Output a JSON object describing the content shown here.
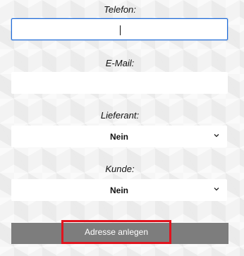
{
  "form": {
    "telefon": {
      "label": "Telefon:",
      "value": ""
    },
    "email": {
      "label": "E-Mail:",
      "value": ""
    },
    "lieferant": {
      "label": "Lieferant:",
      "selected": "Nein"
    },
    "kunde": {
      "label": "Kunde:",
      "selected": "Nein"
    },
    "submit_label": "Adresse anlegen"
  },
  "colors": {
    "focus_border": "#1e6ad8",
    "button_background": "#7d7d7d",
    "highlight_border": "#e0141e"
  },
  "icons": {
    "select_arrow": "chevron-down-icon"
  }
}
